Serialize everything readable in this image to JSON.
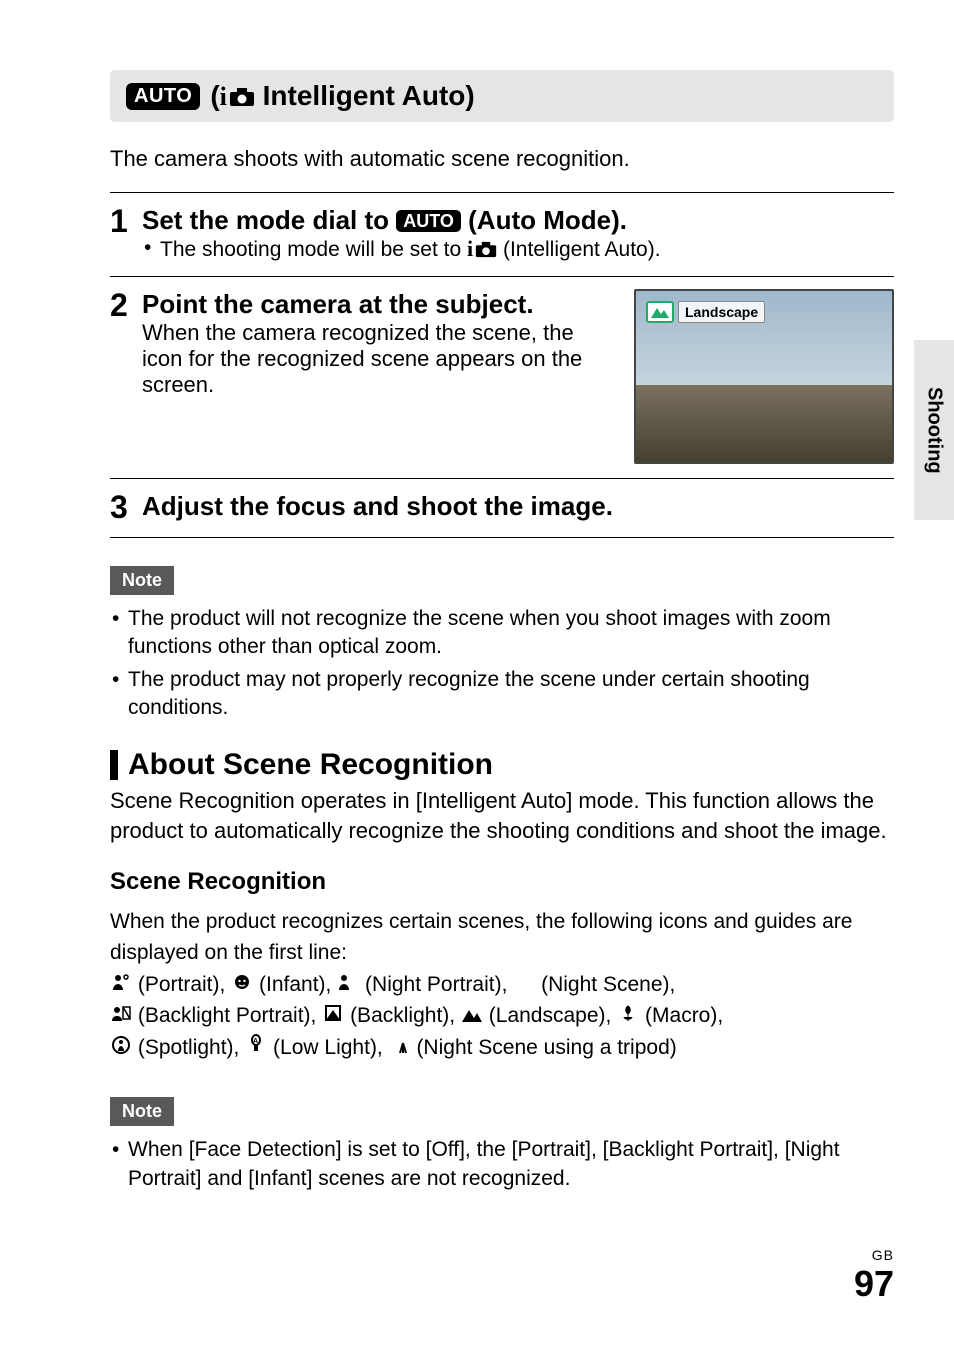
{
  "sideTab": "Shooting",
  "header": {
    "badge": "AUTO",
    "prefix": "(",
    "iGlyph": "i",
    "title": " Intelligent Auto)"
  },
  "intro": "The camera shoots with automatic scene recognition.",
  "steps": {
    "s1": {
      "num": "1",
      "title_pre": "Set the mode dial to ",
      "badge": "AUTO",
      "title_post": " (Auto Mode).",
      "sub_pre": "The shooting mode will be set to ",
      "sub_post": " (Intelligent Auto)."
    },
    "s2": {
      "num": "2",
      "title": "Point the camera at the subject.",
      "body": "When the camera recognized the scene, the icon for the recognized scene appears on the screen.",
      "vf_label": "Landscape"
    },
    "s3": {
      "num": "3",
      "title": "Adjust the focus and shoot the image."
    }
  },
  "note1": {
    "label": "Note",
    "items": [
      "The product will not recognize the scene when you shoot images with zoom functions other than optical zoom.",
      "The product may not properly recognize the scene under certain shooting conditions."
    ]
  },
  "about": {
    "heading": "About Scene Recognition",
    "body": "Scene Recognition operates in [Intelligent Auto] mode. This function allows the product to automatically recognize the shooting conditions and shoot the image."
  },
  "sr": {
    "heading": "Scene Recognition",
    "intro": "When the product recognizes certain scenes, the following icons and guides are displayed on the first line:",
    "scenes": {
      "portrait": " (Portrait), ",
      "infant": " (Infant), ",
      "night_portrait": " (Night Portrait), ",
      "night_scene": " (Night Scene),",
      "backlight_portrait": " (Backlight Portrait), ",
      "backlight": " (Backlight), ",
      "landscape": " (Landscape), ",
      "macro": " (Macro),",
      "spotlight": " (Spotlight), ",
      "low_light": " (Low Light), ",
      "tripod": " (Night Scene using a tripod)"
    }
  },
  "note2": {
    "label": "Note",
    "items": [
      "When [Face Detection] is set to [Off], the [Portrait], [Backlight Portrait], [Night Portrait] and [Infant] scenes are not recognized."
    ]
  },
  "footer": {
    "region": "GB",
    "page": "97"
  }
}
